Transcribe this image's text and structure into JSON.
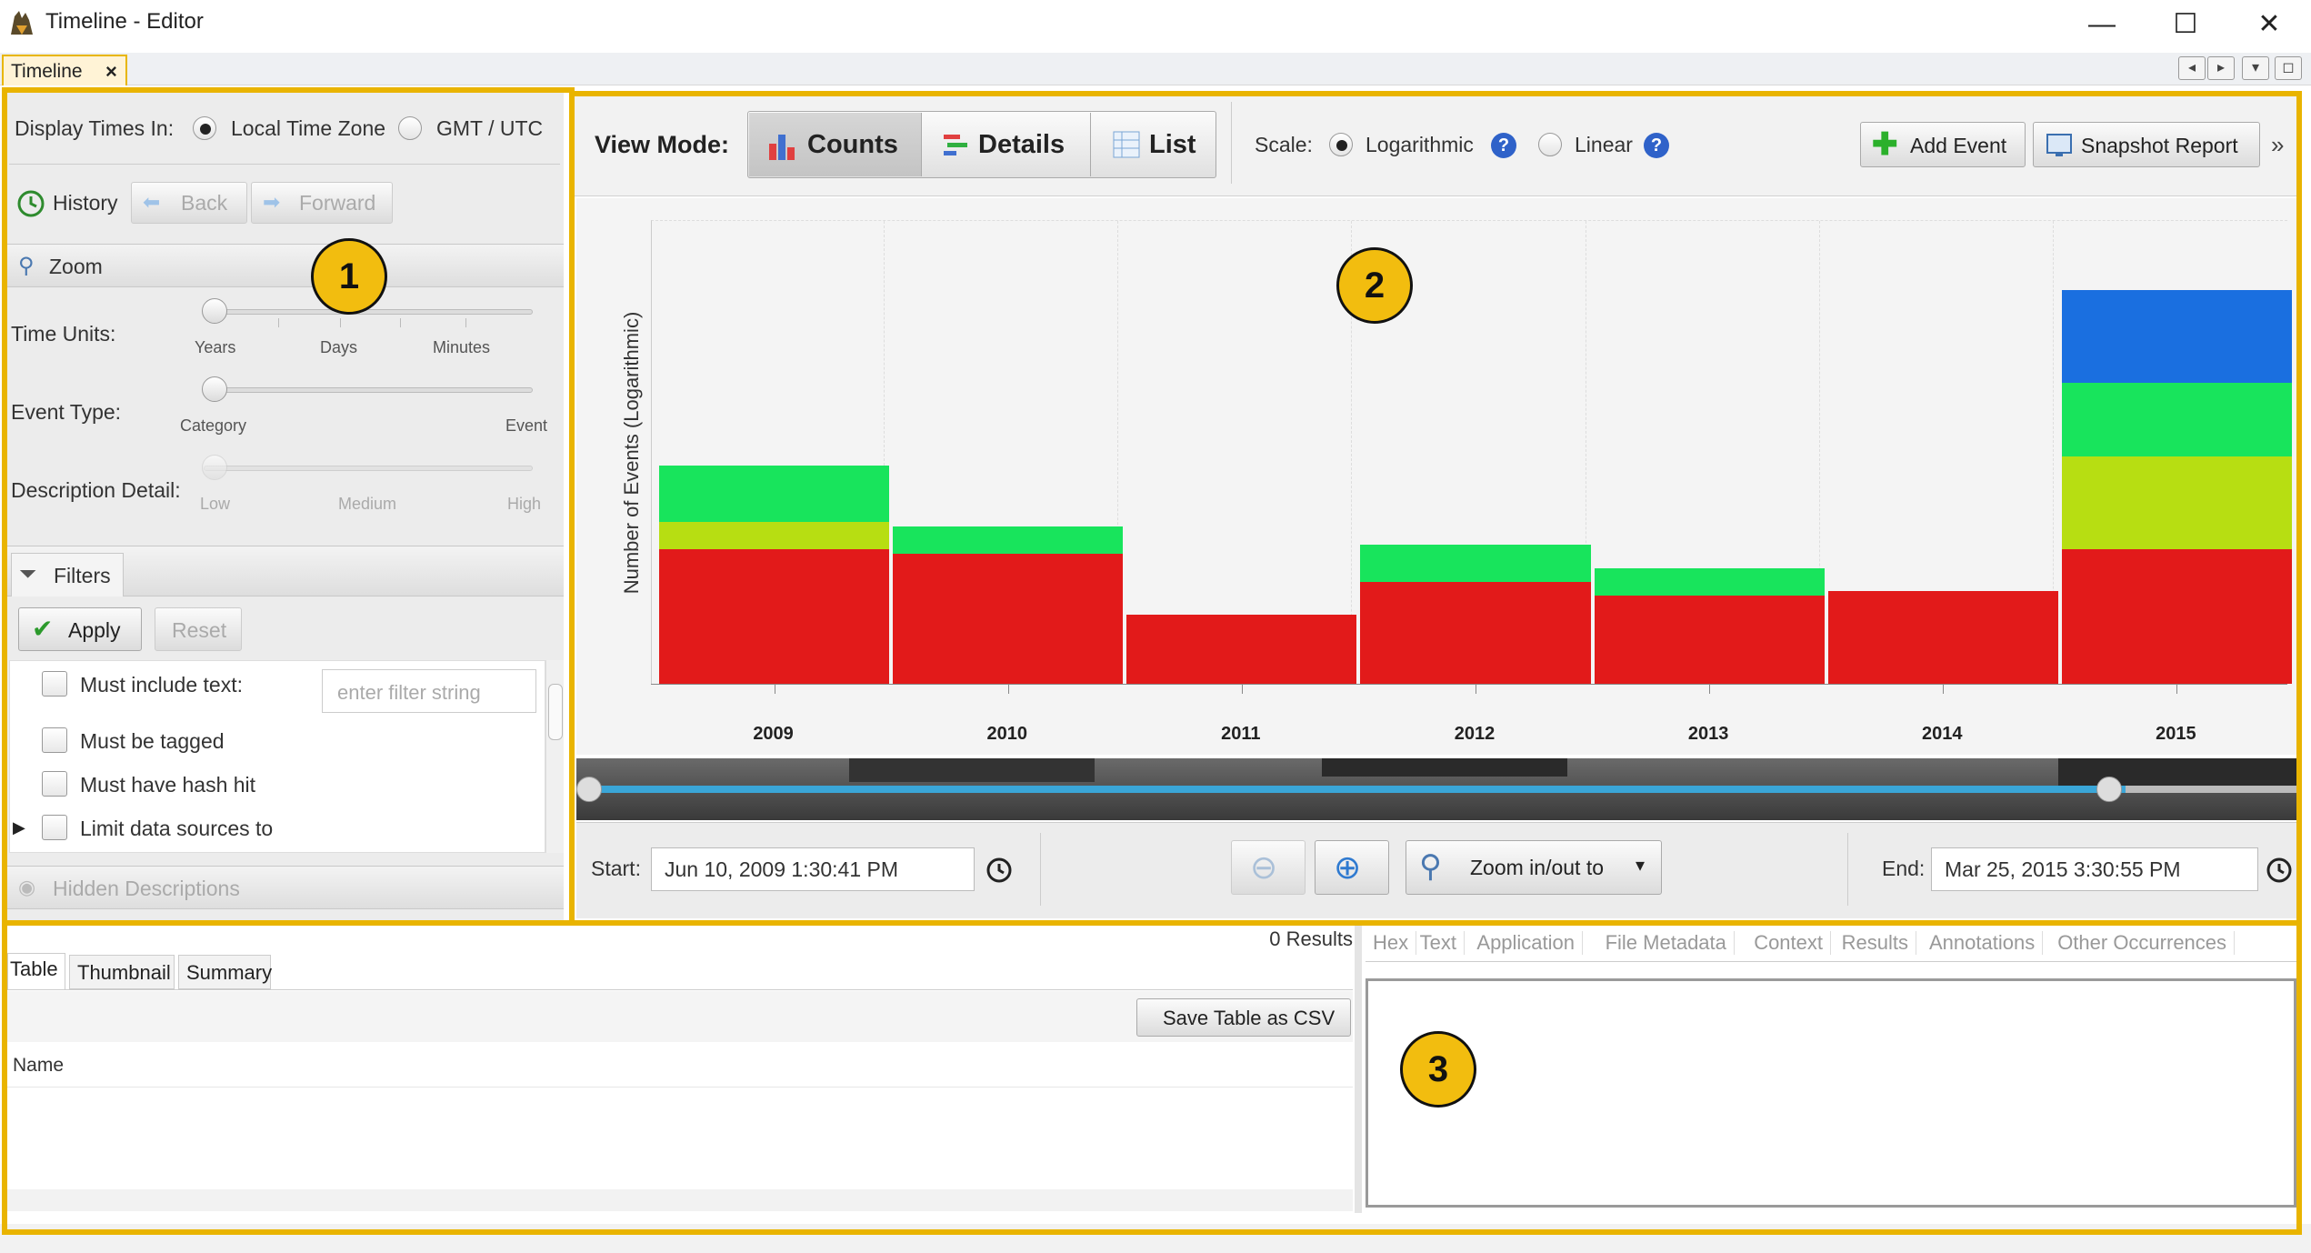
{
  "window": {
    "title": "Timeline - Editor",
    "minimize": "—",
    "maximize": "☐",
    "close": "✕"
  },
  "tabs": {
    "doc_tab": "Timeline",
    "doc_tab_close": "×"
  },
  "badges": {
    "one": "1",
    "two": "2",
    "three": "3"
  },
  "left": {
    "display_times_label": "Display Times In:",
    "tz_local": "Local Time Zone",
    "tz_gmt": "GMT / UTC",
    "history": "History",
    "back": "Back",
    "forward": "Forward",
    "zoom": "Zoom",
    "time_units": "Time Units:",
    "time_units_ticks": [
      "Years",
      "Days",
      "Minutes"
    ],
    "event_type": "Event Type:",
    "event_type_ticks": [
      "Category",
      "Event"
    ],
    "desc_detail": "Description Detail:",
    "desc_detail_ticks": [
      "Low",
      "Medium",
      "High"
    ],
    "filters": "Filters",
    "apply": "Apply",
    "reset": "Reset",
    "filter_items": [
      "Must include text:",
      "Must be tagged",
      "Must have hash hit",
      "Limit data sources to"
    ],
    "filter_placeholder": "enter filter string",
    "hidden_desc": "Hidden Descriptions"
  },
  "toolbar": {
    "view_mode": "View Mode:",
    "counts": "Counts",
    "details": "Details",
    "list": "List",
    "scale": "Scale:",
    "logarithmic": "Logarithmic",
    "linear": "Linear",
    "add_event": "Add Event",
    "snapshot": "Snapshot Report",
    "overflow": "»"
  },
  "chart_data": {
    "type": "bar",
    "stacked": true,
    "ylabel": "Number of Events (Logarithmic)",
    "scale": "logarithmic",
    "categories": [
      "2009",
      "2010",
      "2011",
      "2012",
      "2013",
      "2014",
      "2015"
    ],
    "series": [
      {
        "color": "#e21a1a",
        "values": [
          0.29,
          0.28,
          0.15,
          0.22,
          0.19,
          0.2,
          0.29
        ]
      },
      {
        "color": "#b7de12",
        "values": [
          0.06,
          0.0,
          0.0,
          0.0,
          0.0,
          0.0,
          0.2
        ]
      },
      {
        "color": "#18e45c",
        "values": [
          0.12,
          0.06,
          0.0,
          0.08,
          0.06,
          0.0,
          0.16
        ]
      },
      {
        "color": "#1a6fe0",
        "values": [
          0.0,
          0.0,
          0.0,
          0.0,
          0.0,
          0.0,
          0.2
        ]
      }
    ],
    "grid": true
  },
  "range": {
    "start_label": "Start:",
    "start_value": "Jun 10, 2009 1:30:41 PM",
    "end_label": "End:",
    "end_value": "Mar 25, 2015 3:30:55 PM",
    "zoom_to": "Zoom in/out to"
  },
  "bottom": {
    "results": "0  Results",
    "tabs": [
      "Table",
      "Thumbnail",
      "Summary"
    ],
    "save_csv": "Save Table as CSV",
    "col_name": "Name",
    "content_tabs": [
      "Hex",
      "Text",
      "Application",
      "File Metadata",
      "Context",
      "Results",
      "Annotations",
      "Other Occurrences"
    ]
  }
}
